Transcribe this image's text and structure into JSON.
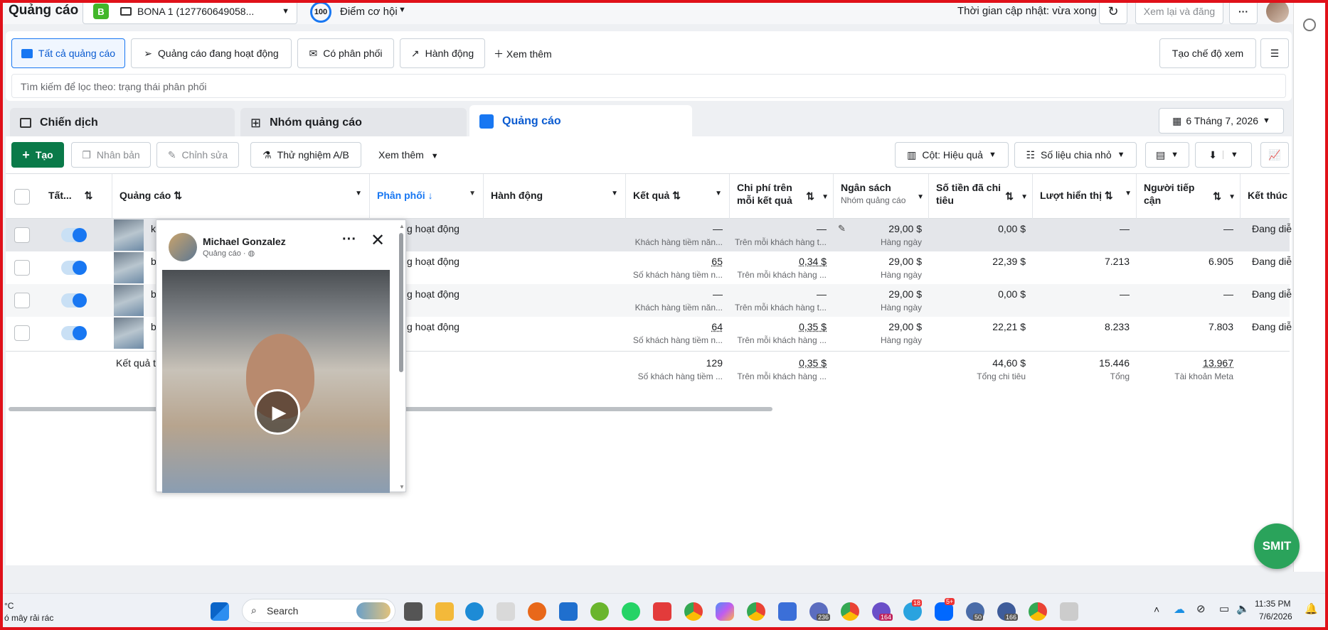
{
  "header": {
    "title": "Quảng cáo",
    "account_badge": "B",
    "account_name": "BONA 1 (127760649058...",
    "score_value": "100",
    "score_label": "Điểm cơ hội",
    "update_text": "Thời gian cập nhật: vừa xong",
    "review_button": "Xem lại và đăng",
    "more_button": "···"
  },
  "filters": {
    "tabs": [
      "Tất cả quảng cáo",
      "Quảng cáo đang hoạt động",
      "Có phân phối",
      "Hành động"
    ],
    "see_more": "Xem thêm",
    "create_view": "Tạo chế độ xem",
    "search_placeholder": "Tìm kiếm để lọc theo: trạng thái phân phối"
  },
  "level_tabs": {
    "campaign": "Chiến dịch",
    "adset": "Nhóm quảng cáo",
    "ad": "Quảng cáo",
    "date_range": "6 Tháng 7, 2026"
  },
  "toolbar": {
    "create": "Tạo",
    "duplicate": "Nhân bản",
    "edit": "Chỉnh sửa",
    "ab_test": "Thử nghiệm A/B",
    "see_more": "Xem thêm",
    "columns": "Cột: Hiệu quả",
    "breakdown": "Số liệu chia nhỏ"
  },
  "table": {
    "headers": {
      "onoff": "Tất...",
      "ad": "Quảng cáo",
      "delivery": "Phân phối",
      "actions": "Hành động",
      "results": "Kết quả",
      "cost_line1": "Chi phí trên",
      "cost_line2": "mỗi kết quả",
      "budget": "Ngân sách",
      "budget_sub": "Nhóm quảng cáo",
      "spent_line1": "Số tiền đã chi",
      "spent_line2": "tiêu",
      "impressions": "Lượt hiển thị",
      "reach_line1": "Người tiếp",
      "reach_line2": "cận",
      "end": "Kết thúc"
    },
    "rows": [
      {
        "name": "k",
        "delivery": "g hoạt động",
        "results": "—",
        "results_sub": "Khách hàng tiềm năn...",
        "cost": "—",
        "cost_sub": "Trên mỗi khách hàng t...",
        "budget": "29,00 $",
        "budget_sub": "Hàng ngày",
        "spent": "0,00 $",
        "impressions": "—",
        "reach": "—",
        "end": "Đang diễ"
      },
      {
        "name": "b",
        "delivery": "g hoạt động",
        "results": "65",
        "results_sub": "Số khách hàng tiềm n...",
        "cost": "0,34 $",
        "cost_sub": "Trên mỗi khách hàng ...",
        "budget": "29,00 $",
        "budget_sub": "Hàng ngày",
        "spent": "22,39 $",
        "impressions": "7.213",
        "reach": "6.905",
        "end": "Đang diễ"
      },
      {
        "name": "b",
        "delivery": "g hoạt động",
        "results": "—",
        "results_sub": "Khách hàng tiềm năn...",
        "cost": "—",
        "cost_sub": "Trên mỗi khách hàng t...",
        "budget": "29,00 $",
        "budget_sub": "Hàng ngày",
        "spent": "0,00 $",
        "impressions": "—",
        "reach": "—",
        "end": "Đang diễ"
      },
      {
        "name": "b",
        "delivery": "g hoạt động",
        "results": "64",
        "results_sub": "Số khách hàng tiềm n...",
        "cost": "0,35 $",
        "cost_sub": "Trên mỗi khách hàng ...",
        "budget": "29,00 $",
        "budget_sub": "Hàng ngày",
        "spent": "22,21 $",
        "impressions": "8.233",
        "reach": "7.803",
        "end": "Đang diễ"
      }
    ],
    "totals": {
      "label": "Kết quả t",
      "results": "129",
      "results_sub": "Số khách hàng tiềm ...",
      "cost": "0,35 $",
      "cost_sub": "Trên mỗi khách hàng ...",
      "spent": "44,60 $",
      "spent_sub": "Tổng chi tiêu",
      "impressions": "15.446",
      "impressions_sub": "Tổng",
      "reach": "13.967",
      "reach_sub": "Tài khoản Meta"
    }
  },
  "preview": {
    "page_name": "Michael Gonzalez",
    "sponsored": "Quảng cáo · "
  },
  "chat_bubble": "SMIT",
  "taskbar": {
    "weather_temp": "°C",
    "weather_desc": "ó mây rải rác",
    "search": "Search",
    "badges": [
      "236",
      "164",
      "18",
      "5+",
      "50",
      "166"
    ],
    "time": "11:35 PM",
    "date": "7/6/2026"
  },
  "colors": {
    "accent": "#1877f2",
    "primary_green": "#0a7a49",
    "frame": "#e0111a"
  }
}
